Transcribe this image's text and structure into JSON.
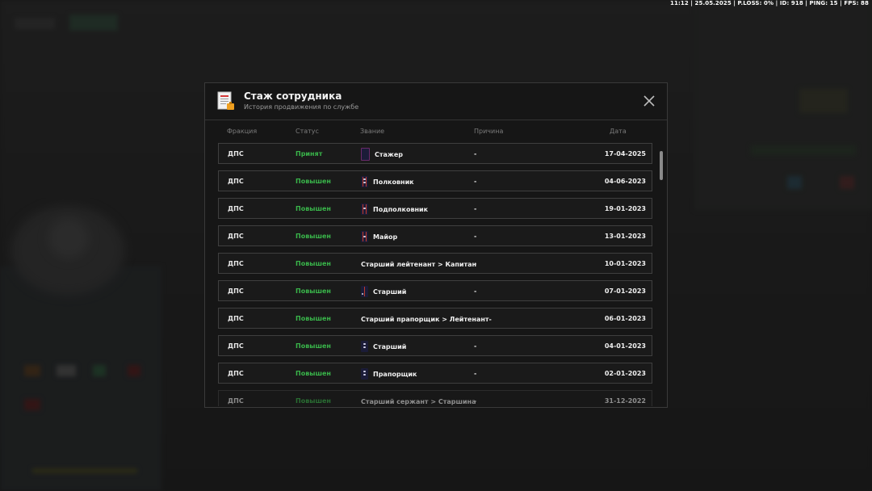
{
  "hud": {
    "text": "11:12 | 25.05.2025 | P.LOSS: 0% | ID: 918 | PING: 15 | FPS: 88"
  },
  "modal": {
    "title": "Стаж сотрудника",
    "subtitle": "История продвижения по службе",
    "icon": "document-icon",
    "close_icon": "close-icon"
  },
  "table": {
    "headers": {
      "faction": "Фракция",
      "status": "Статус",
      "rank": "Звание",
      "reason": "Причина",
      "date": "Дата"
    },
    "rows": [
      {
        "faction": "ДПС",
        "status": "Принят",
        "rank": "Стажер",
        "rank_icon": "empty-shoulder-strap-icon",
        "reason": "-",
        "date": "17-04-2025"
      },
      {
        "faction": "ДПС",
        "status": "Повышен",
        "rank": "Полковник",
        "rank_icon": "colonel-shoulder-strap-icon",
        "reason": "-",
        "date": "04-06-2023"
      },
      {
        "faction": "ДПС",
        "status": "Повышен",
        "rank": "Подполковник",
        "rank_icon": "lt-colonel-shoulder-strap-icon",
        "reason": "-",
        "date": "19-01-2023"
      },
      {
        "faction": "ДПС",
        "status": "Повышен",
        "rank": "Майор",
        "rank_icon": "major-shoulder-strap-icon",
        "reason": "-",
        "date": "13-01-2023"
      },
      {
        "faction": "ДПС",
        "status": "Повышен",
        "rank": "Старший лейтенант > Капитан",
        "rank_icon": "",
        "reason": "-",
        "date": "10-01-2023"
      },
      {
        "faction": "ДПС",
        "status": "Повышен",
        "rank": "Старший",
        "rank_icon": "senior-shoulder-strap-icon",
        "reason": "-",
        "date": "07-01-2023"
      },
      {
        "faction": "ДПС",
        "status": "Повышен",
        "rank": "Старший прапорщик > Лейтенант-",
        "rank_icon": "",
        "reason": "",
        "date": "06-01-2023"
      },
      {
        "faction": "ДПС",
        "status": "Повышен",
        "rank": "Старший",
        "rank_icon": "senior-ensign-shoulder-strap-icon",
        "reason": "-",
        "date": "04-01-2023"
      },
      {
        "faction": "ДПС",
        "status": "Повышен",
        "rank": "Прапорщик",
        "rank_icon": "ensign-shoulder-strap-icon",
        "reason": "-",
        "date": "02-01-2023"
      },
      {
        "faction": "ДПС",
        "status": "Повышен",
        "rank": "Старший сержант > Старшина",
        "rank_icon": "",
        "reason": "-",
        "date": "31-12-2022"
      }
    ]
  },
  "colors": {
    "accent_status": "#39b54a",
    "modal_bg": "#161616",
    "border": "#3f3f3f"
  }
}
